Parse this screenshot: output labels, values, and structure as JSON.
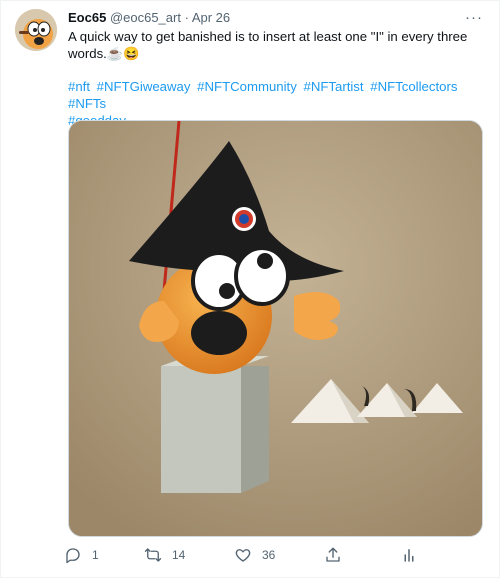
{
  "tweet": {
    "display_name": "Eoc65",
    "handle": "@eoc65_art",
    "separator": "·",
    "date": "Apr 26",
    "more_label": "···",
    "text": "A quick way to get banished is to insert at least one \"I\" in every three words.☕😆",
    "hashtags": [
      "#nft",
      "#NFTGiweaway",
      "#NFTCommunity",
      "#NFTartist",
      "#NFTcollectors",
      "#NFTs",
      "#goodday"
    ]
  },
  "actions": {
    "reply_count": "1",
    "retweet_count": "14",
    "like_count": "36"
  },
  "icons": {
    "reply": "reply-icon",
    "retweet": "retweet-icon",
    "like": "heart-icon",
    "share": "share-icon",
    "analytics": "analytics-icon",
    "more": "more-icon"
  },
  "colors": {
    "link": "#1d9bf0",
    "muted": "#536471",
    "text": "#0f1419"
  }
}
